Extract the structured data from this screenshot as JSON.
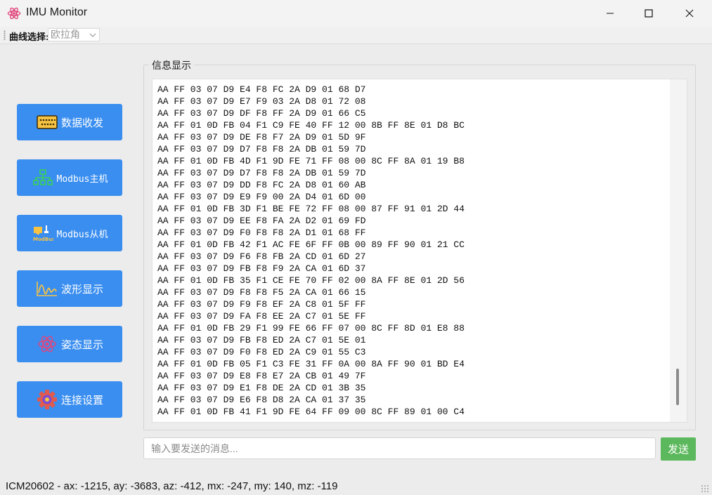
{
  "window": {
    "title": "IMU Monitor"
  },
  "toolbar": {
    "curve_label": "曲线选择:",
    "curve_selected": "欧拉角"
  },
  "sidebar": {
    "items": [
      {
        "label": "数据收发",
        "icon": "serial-port-icon"
      },
      {
        "label": "Modbus主机",
        "icon": "network-tree-icon"
      },
      {
        "label": "Modbus从机",
        "icon": "modbus-slave-icon"
      },
      {
        "label": "波形显示",
        "icon": "waveform-icon"
      },
      {
        "label": "姿态显示",
        "icon": "attitude-icon"
      },
      {
        "label": "连接设置",
        "icon": "gear-icon"
      }
    ]
  },
  "info": {
    "title": "信息显示",
    "lines": [
      "AA FF 03 07 D9 E4 F8 FC 2A D9 01 68 D7",
      "AA FF 03 07 D9 E7 F9 03 2A D8 01 72 08",
      "AA FF 03 07 D9 DF F8 FF 2A D9 01 66 C5",
      "AA FF 01 0D FB 04 F1 C9 FE 40 FF 12 00 8B FF 8E 01 D8 BC",
      "AA FF 03 07 D9 DE F8 F7 2A D9 01 5D 9F",
      "AA FF 03 07 D9 D7 F8 F8 2A DB 01 59 7D",
      "AA FF 01 0D FB 4D F1 9D FE 71 FF 08 00 8C FF 8A 01 19 B8",
      "AA FF 03 07 D9 D7 F8 F8 2A DB 01 59 7D",
      "AA FF 03 07 D9 DD F8 FC 2A D8 01 60 AB",
      "AA FF 03 07 D9 E9 F9 00 2A D4 01 6D 00",
      "AA FF 01 0D FB 3D F1 BE FE 72 FF 08 00 87 FF 91 01 2D 44",
      "AA FF 03 07 D9 EE F8 FA 2A D2 01 69 FD",
      "AA FF 03 07 D9 F0 F8 F8 2A D1 01 68 FF",
      "AA FF 01 0D FB 42 F1 AC FE 6F FF 0B 00 89 FF 90 01 21 CC",
      "AA FF 03 07 D9 F6 F8 FB 2A CD 01 6D 27",
      "AA FF 03 07 D9 FB F8 F9 2A CA 01 6D 37",
      "AA FF 01 0D FB 35 F1 CE FE 70 FF 02 00 8A FF 8E 01 2D 56",
      "AA FF 03 07 D9 F8 F8 F5 2A CA 01 66 15",
      "AA FF 03 07 D9 F9 F8 EF 2A C8 01 5F FF",
      "AA FF 03 07 D9 FA F8 EE 2A C7 01 5E FF",
      "AA FF 01 0D FB 29 F1 99 FE 66 FF 07 00 8C FF 8D 01 E8 88",
      "AA FF 03 07 D9 FB F8 ED 2A C7 01 5E 01",
      "AA FF 03 07 D9 F0 F8 ED 2A C9 01 55 C3",
      "AA FF 01 0D FB 05 F1 C3 FE 31 FF 0A 00 8A FF 90 01 BD E4",
      "AA FF 03 07 D9 E8 F8 E7 2A CB 01 49 7F",
      "AA FF 03 07 D9 E1 F8 DE 2A CD 01 3B 35",
      "AA FF 03 07 D9 E6 F8 D8 2A CA 01 37 35",
      "AA FF 01 0D FB 41 F1 9D FE 64 FF 09 00 8C FF 89 01 00 C4"
    ]
  },
  "input": {
    "placeholder": "输入要发送的消息...",
    "value": ""
  },
  "send": {
    "label": "发送"
  },
  "status": {
    "text": "ICM20602 - ax: -1215, ay: -3683, az: -412, mx: -247, my: 140, mz: -119"
  },
  "colors": {
    "nav_button": "#3a8ef0",
    "send_button": "#5cb85c"
  }
}
